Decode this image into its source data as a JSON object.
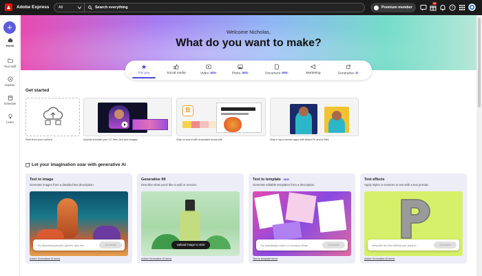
{
  "app": {
    "title": "Adobe Express"
  },
  "search": {
    "scope": "All",
    "placeholder": "Search everything"
  },
  "premium": {
    "label": "Premium member"
  },
  "topbar_icons": [
    "message-icon",
    "gift-icon",
    "notifications-icon",
    "help-icon",
    "apps-grid-icon",
    "avatar"
  ],
  "notification_count": "15",
  "rail": {
    "create_label": "+",
    "items": [
      {
        "label": "Home",
        "icon": "home-icon"
      },
      {
        "label": "Your stuff",
        "icon": "folder-icon"
      },
      {
        "label": "Explore",
        "icon": "compass-icon"
      },
      {
        "label": "Schedule",
        "icon": "calendar-icon"
      },
      {
        "label": "Learn",
        "icon": "bulb-icon"
      }
    ]
  },
  "hero": {
    "welcome": "Welcome Nicholas,",
    "title": "What do you want to make?"
  },
  "tabs": [
    {
      "label": "For you",
      "icon": "star-icon",
      "badge": ""
    },
    {
      "label": "Social media",
      "icon": "thumbs-up-icon",
      "badge": ""
    },
    {
      "label": "Video",
      "icon": "play-icon",
      "badge": "NEW"
    },
    {
      "label": "Photo",
      "icon": "image-icon",
      "badge": "NEW"
    },
    {
      "label": "Document",
      "icon": "document-icon",
      "badge": "NEW"
    },
    {
      "label": "Marketing",
      "icon": "megaphone-icon",
      "badge": ""
    },
    {
      "label": "Generative",
      "icon": "sparkle-icon",
      "badge": "AI"
    }
  ],
  "get_started": {
    "title": "Get started",
    "cards": [
      {
        "caption": "Start from your content"
      },
      {
        "caption": "Quickly animate your CC files, text and images"
      },
      {
        "caption": "Stay on brand with shareable brand kits"
      },
      {
        "caption": "Stay in sync across apps with linked Ps and Ai files"
      }
    ]
  },
  "gen_ai": {
    "title": "Let your imagination soar with generative AI",
    "cards": [
      {
        "title": "Text to image",
        "badge": "",
        "desc": "Generate images from a detailed text description.",
        "prompt": "Try describing people, places, and mo...",
        "button": "Generate",
        "terms": "Adobe Generative AI terms"
      },
      {
        "title": "Generative fill",
        "badge": "",
        "desc": "Describe what you'd like to add or remove.",
        "prompt": "",
        "button": "Upload image to start",
        "terms": "Adobe Generative AI terms"
      },
      {
        "title": "Text to template",
        "badge": "NEW",
        "desc": "Generate editable templates from a description.",
        "prompt": "Try specifying a topic or occasion (Eng...",
        "button": "Generate",
        "terms": "Text to template terms"
      },
      {
        "title": "Text effects",
        "badge": "",
        "desc": "Apply styles or textures to text with a text prompt.",
        "prompt": "Describe the text effects you want to ...",
        "button": "Generate",
        "terms": "Adobe Generative AI terms"
      }
    ]
  },
  "colors": {
    "accent": "#4b4bd6",
    "topbar": "#1b1b1b",
    "ai_card_bg": "#ededf8"
  }
}
